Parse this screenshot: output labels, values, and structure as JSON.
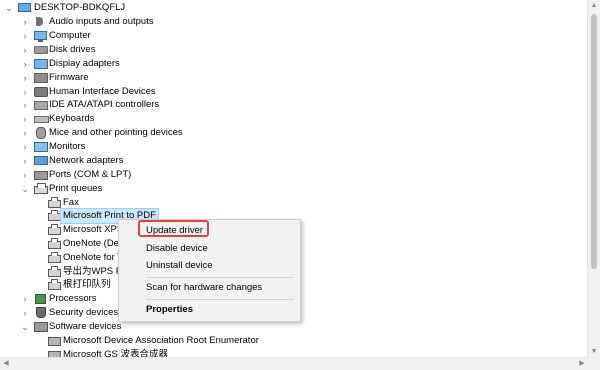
{
  "tree": {
    "root_label": "DESKTOP-BDKQFLJ",
    "categories": [
      {
        "label": "Audio inputs and outputs",
        "icon": "speaker-icon"
      },
      {
        "label": "Computer",
        "icon": "computer-icon"
      },
      {
        "label": "Disk drives",
        "icon": "disk-drive-icon"
      },
      {
        "label": "Display adapters",
        "icon": "display-adapter-icon"
      },
      {
        "label": "Firmware",
        "icon": "firmware-chip-icon"
      },
      {
        "label": "Human Interface Devices",
        "icon": "hid-icon"
      },
      {
        "label": "IDE ATA/ATAPI controllers",
        "icon": "ide-controller-icon"
      },
      {
        "label": "Keyboards",
        "icon": "keyboard-icon"
      },
      {
        "label": "Mice and other pointing devices",
        "icon": "mouse-icon"
      },
      {
        "label": "Monitors",
        "icon": "monitor-icon"
      },
      {
        "label": "Network adapters",
        "icon": "network-adapter-icon"
      },
      {
        "label": "Ports (COM & LPT)",
        "icon": "port-icon"
      },
      {
        "label": "Print queues",
        "icon": "print-queue-icon"
      }
    ],
    "print_queue_items": [
      {
        "label": "Fax"
      },
      {
        "label": "Microsoft Print to PDF"
      },
      {
        "label": "Microsoft XPS"
      },
      {
        "label": "OneNote (Des"
      },
      {
        "label": "OneNote for W"
      },
      {
        "label": "导出为WPS P"
      },
      {
        "label": "根打印队列"
      }
    ],
    "after_categories": [
      {
        "label": "Processors"
      },
      {
        "label": "Security devices"
      },
      {
        "label": "Software devices"
      }
    ],
    "software_items": [
      {
        "label": "Microsoft Device Association Root Enumerator"
      },
      {
        "label": "Microsoft GS 波表合成器"
      }
    ]
  },
  "context_menu": {
    "items": {
      "update_driver": "Update driver",
      "disable_device": "Disable device",
      "uninstall_device": "Uninstall device",
      "scan_hardware": "Scan for hardware changes",
      "properties": "Properties"
    },
    "highlight_color": "#e0463c"
  },
  "colors": {
    "selection_bg": "#cce8ff",
    "menu_bg": "#f2f2f2"
  }
}
